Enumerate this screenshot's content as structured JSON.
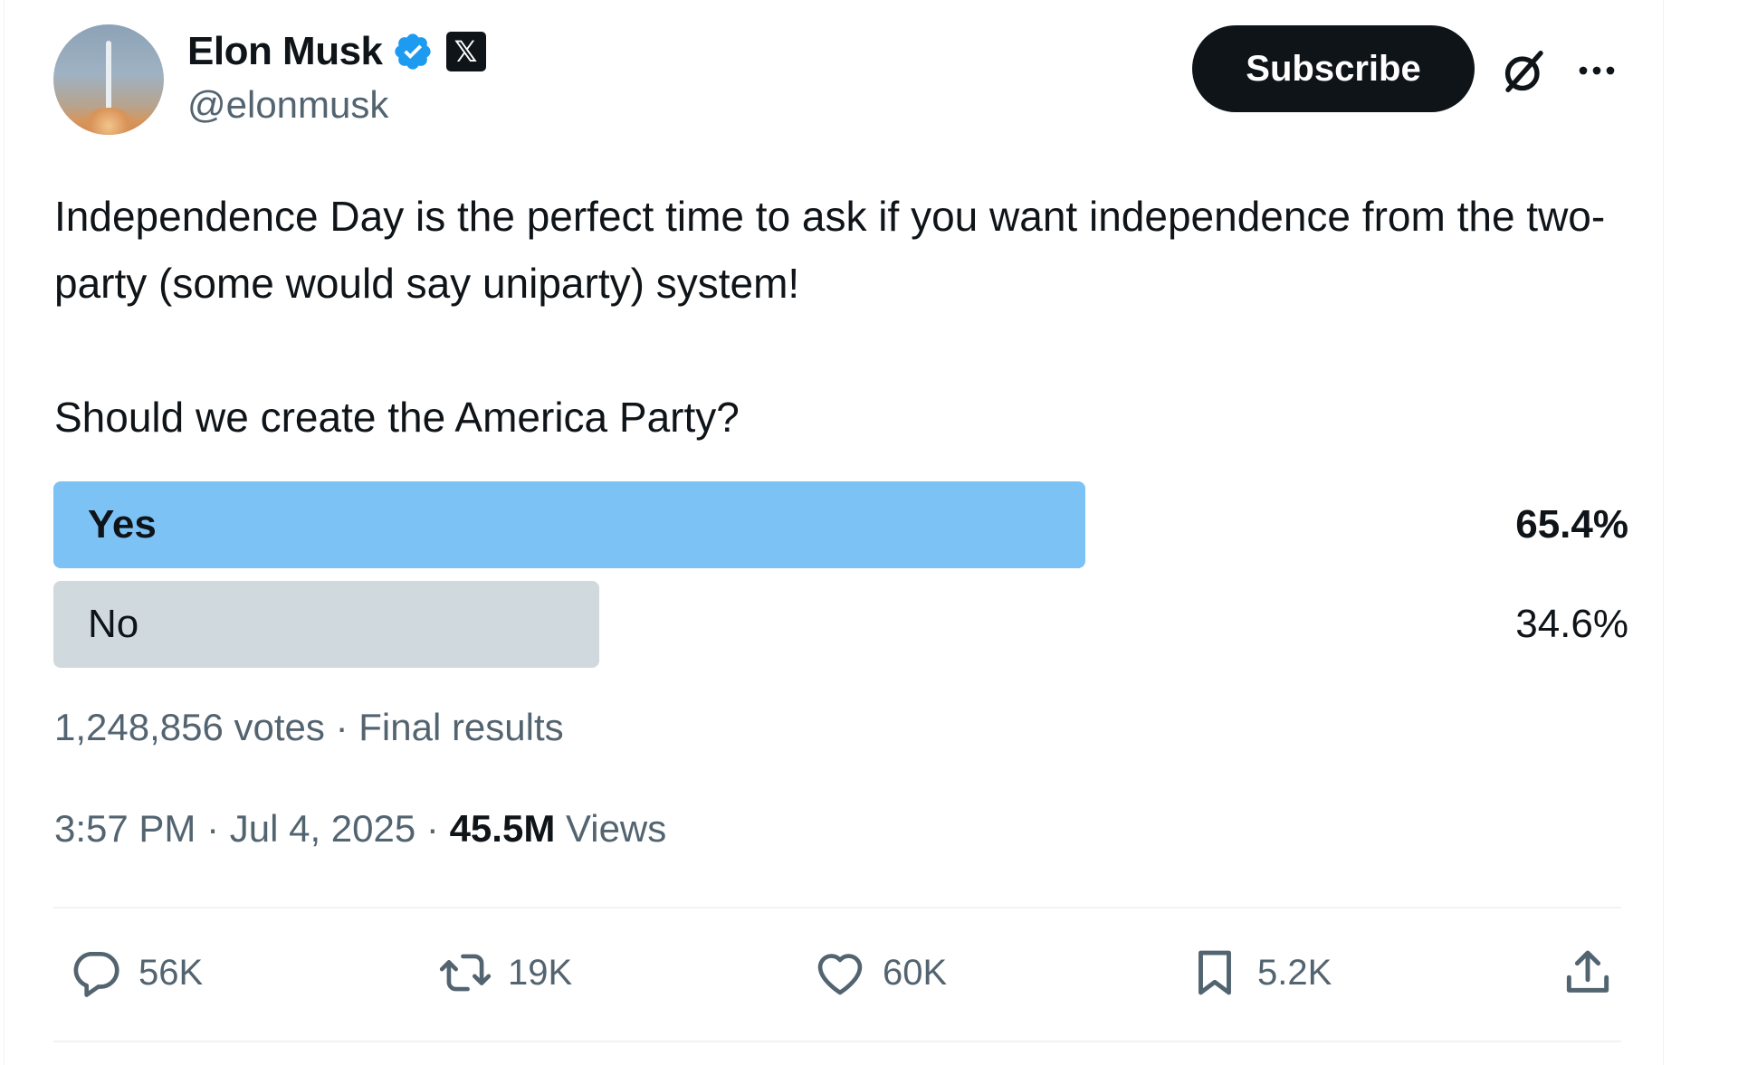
{
  "author": {
    "name": "Elon Musk",
    "handle": "@elonmusk",
    "verified": true,
    "affiliation_badge": "𝕏"
  },
  "header": {
    "subscribe_label": "Subscribe",
    "icons": [
      "grok-icon",
      "more-icon"
    ]
  },
  "tweet": {
    "line1": "Independence Day is the perfect time to ask if you want independence from the two-party (some would say uniparty) system!",
    "line2": "Should we create the America Party?"
  },
  "poll": {
    "options": [
      {
        "label": "Yes",
        "percent_text": "65.4%",
        "percent": 65.4,
        "winner": true
      },
      {
        "label": "No",
        "percent_text": "34.6%",
        "percent": 34.6,
        "winner": false
      }
    ],
    "votes": "1,248,856 votes",
    "separator": " · ",
    "status": "Final results"
  },
  "meta": {
    "time": "3:57 PM",
    "date": "Jul 4, 2025",
    "views_count": "45.5M",
    "views_label": "Views",
    "separator": " · "
  },
  "actions": {
    "replies": "56K",
    "reposts": "19K",
    "likes": "60K",
    "bookmarks": "5.2K"
  },
  "colors": {
    "winner_bar": "#7cc2f5",
    "loser_bar": "#cfd9de",
    "verified_blue": "#1d9bf0",
    "text_primary": "#0f1419",
    "text_secondary": "#536471"
  }
}
